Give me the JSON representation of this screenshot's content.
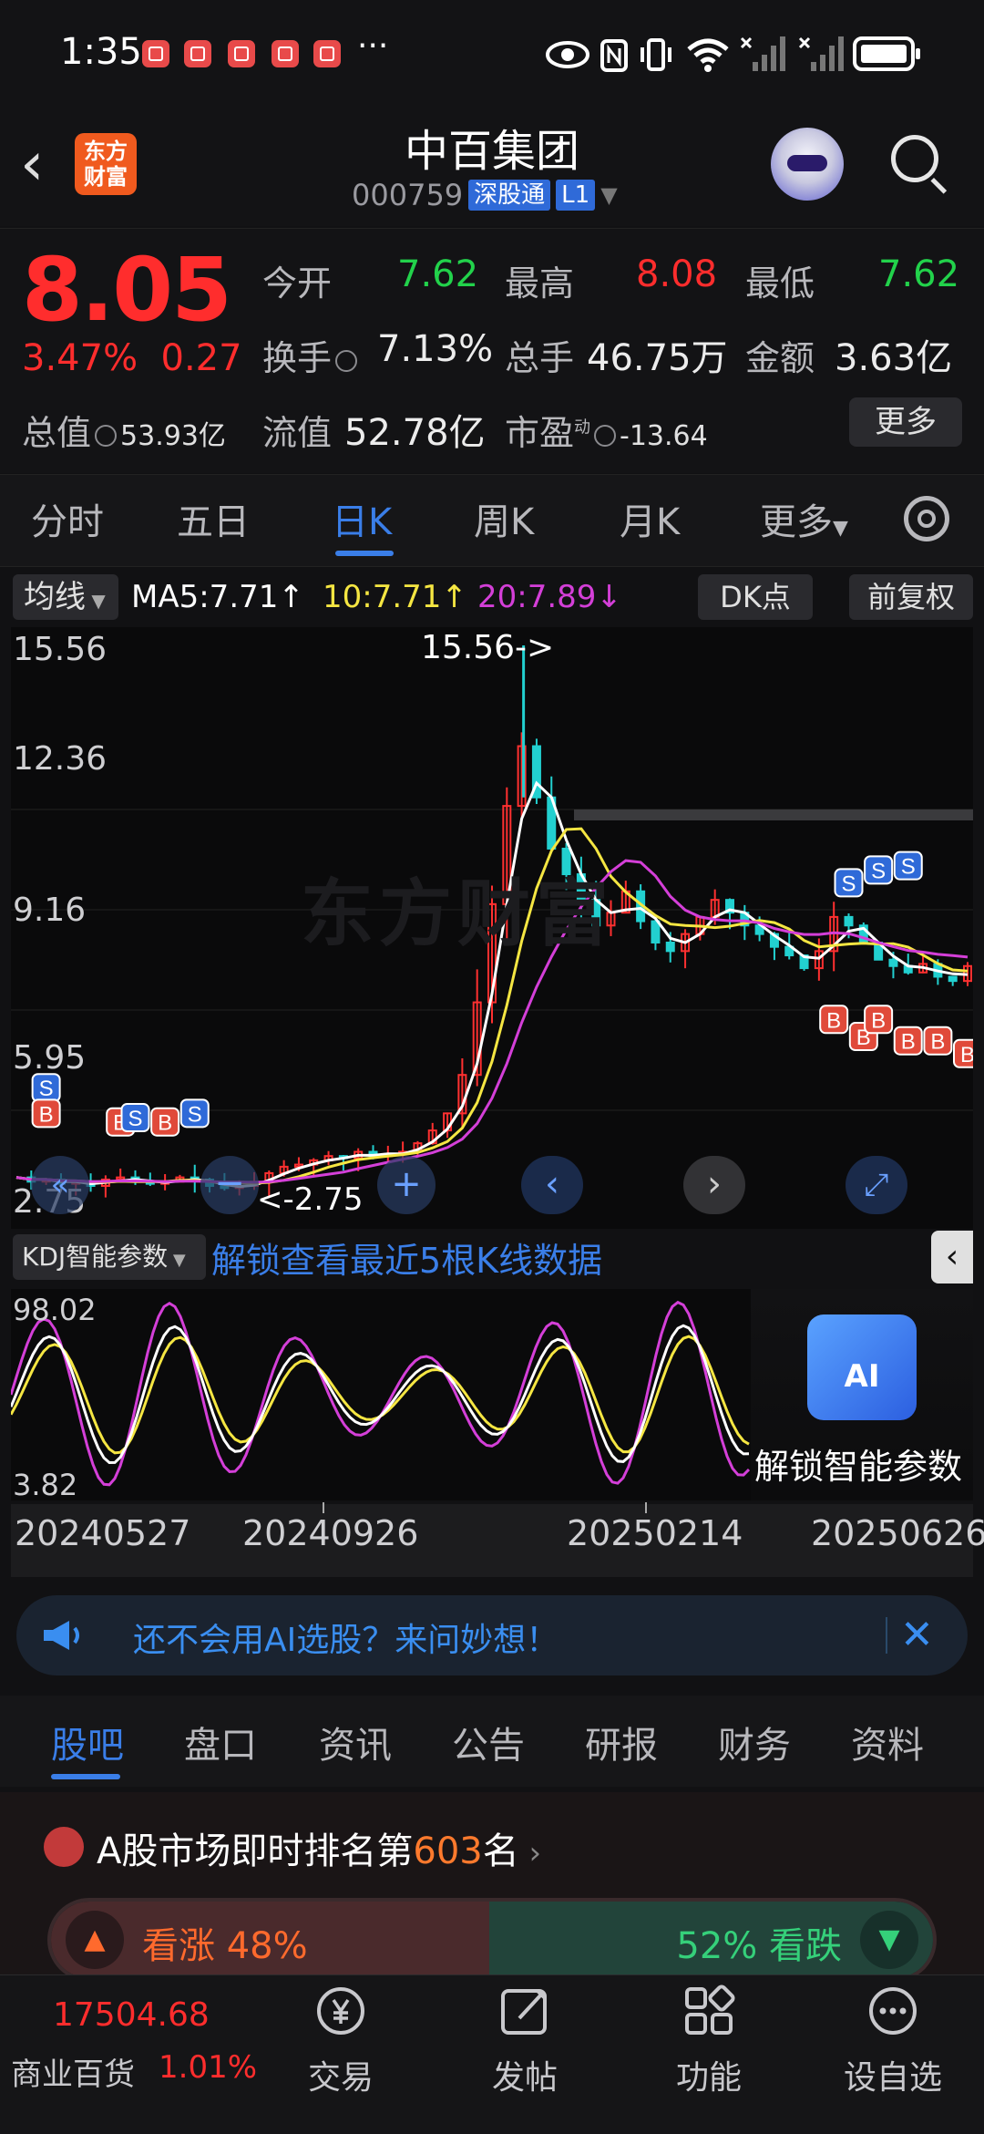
{
  "status_bar": {
    "time": "1:35",
    "more": "···"
  },
  "header": {
    "logo_text": "东方\n财富",
    "stock_name": "中百集团",
    "stock_code": "000759",
    "badge_connect": "深股通",
    "badge_level": "L1"
  },
  "quote": {
    "price": "8.05",
    "change_pct": "3.47%",
    "change_amt": "0.27",
    "open_label": "今开",
    "open_value": "7.62",
    "high_label": "最高",
    "high_value": "8.08",
    "low_label": "最低",
    "low_value": "7.62",
    "turnover_label": "换手",
    "turnover_value": "7.13%",
    "volume_label": "总手",
    "volume_value": "46.75万",
    "amount_label": "金额",
    "amount_value": "3.63亿",
    "mktcap_label": "总值",
    "mktcap_value": "53.93亿",
    "float_label": "流值",
    "float_value": "52.78亿",
    "pe_label": "市盈",
    "pe_sup": "动",
    "pe_value": "-13.64",
    "more_button": "更多"
  },
  "period_tabs": [
    "分时",
    "五日",
    "日K",
    "周K",
    "月K",
    "更多"
  ],
  "period_active": "日K",
  "ma_bar": {
    "ma_button": "均线",
    "ma5": "MA5:7.71↑",
    "ma10": "10:7.71↑",
    "ma20": "20:7.89↓",
    "dk_button": "DK点",
    "adjust_button": "前复权"
  },
  "kchart": {
    "y_labels": [
      "15.56",
      "12.36",
      "9.16",
      "5.95",
      "2.75"
    ],
    "high_marker": "15.56->",
    "low_marker": "<-2.75",
    "watermark": "东方财富"
  },
  "kdj": {
    "button": "KDJ智能参数",
    "unlock_text": "解锁查看最近5根K线数据",
    "y_top": "98.02",
    "y_bottom": "3.82",
    "ai_icon_text": "AI",
    "ai_label": "解锁智能参数"
  },
  "dates": [
    "20240527",
    "20240926",
    "20250214",
    "20250626"
  ],
  "banner": {
    "text": "还不会用AI选股？来问妙想！"
  },
  "info_tabs": [
    "股吧",
    "盘口",
    "资讯",
    "公告",
    "研报",
    "财务",
    "资料"
  ],
  "info_active": "股吧",
  "ranking": {
    "prefix": "A股市场即时排名第",
    "rank": "603",
    "suffix": "名",
    "bull_label": "看涨 48%",
    "bear_label": "52% 看跌",
    "bull_pct": 48
  },
  "bottom_nav": {
    "index_value": "17504.68",
    "index_name": "商业百货",
    "index_change": "1.01%",
    "items": [
      "交易",
      "发帖",
      "功能",
      "设自选"
    ]
  },
  "colors": {
    "up": "#ff2d2d",
    "down": "#22d24b",
    "accent": "#3a7ee8",
    "ma5": "#ffffff",
    "ma10": "#f5e642",
    "ma20": "#d43fd8"
  },
  "chart_data": {
    "type": "candlestick",
    "ylim": [
      2.75,
      15.56
    ],
    "series": [
      {
        "name": "MA5",
        "color": "#ffffff"
      },
      {
        "name": "MA10",
        "color": "#f5e642"
      },
      {
        "name": "MA20",
        "color": "#d43fd8"
      }
    ],
    "close_path": [
      3.1,
      3.0,
      3.05,
      2.95,
      3.0,
      2.9,
      3.05,
      3.1,
      3.0,
      2.95,
      3.0,
      3.1,
      3.05,
      2.9,
      2.85,
      2.9,
      3.0,
      3.2,
      3.35,
      3.4,
      3.5,
      3.6,
      3.55,
      3.7,
      3.6,
      3.65,
      3.7,
      3.9,
      4.2,
      4.6,
      5.5,
      7.2,
      9.5,
      11.8,
      13.2,
      12.0,
      10.8,
      10.2,
      9.6,
      9.0,
      9.3,
      9.8,
      9.1,
      8.6,
      8.4,
      8.8,
      9.2,
      9.6,
      9.3,
      9.0,
      8.8,
      8.5,
      8.3,
      8.0,
      8.4,
      9.2,
      9.0,
      8.6,
      8.2,
      8.05,
      7.9,
      8.1,
      7.8,
      7.7,
      8.05
    ]
  }
}
